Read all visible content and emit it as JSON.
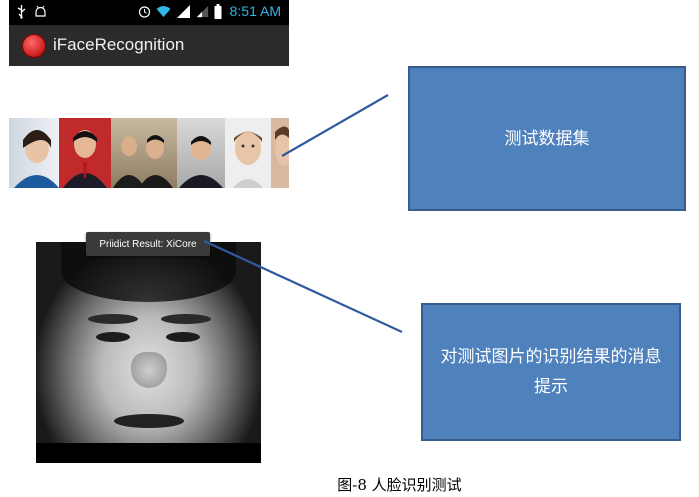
{
  "status_bar": {
    "time": "8:51 AM",
    "icons": [
      "usb-icon",
      "android-icon",
      "alarm-icon",
      "wifi-icon",
      "signal-icon",
      "signal-weak-icon",
      "battery-icon"
    ]
  },
  "action_bar": {
    "app_title": "iFaceRecognition",
    "app_icon": "app-logo-icon"
  },
  "test_dataset_strip": {
    "thumbnails": [
      "face-photo",
      "face-photo",
      "face-photo",
      "face-photo",
      "face-photo",
      "face-photo"
    ]
  },
  "toast": {
    "text": "Priidict Result: XiCore"
  },
  "callouts": [
    {
      "text": "测试数据集"
    },
    {
      "text": "对测试图片的识别结果的消息提示"
    }
  ],
  "caption": "图-8  人脸识别测试",
  "colors": {
    "callout_fill": "#4f81bd",
    "callout_border": "#385d8a",
    "connector_line": "#2f5aa0",
    "action_bar": "#2b2b2b",
    "status_time": "#33b5e5"
  }
}
